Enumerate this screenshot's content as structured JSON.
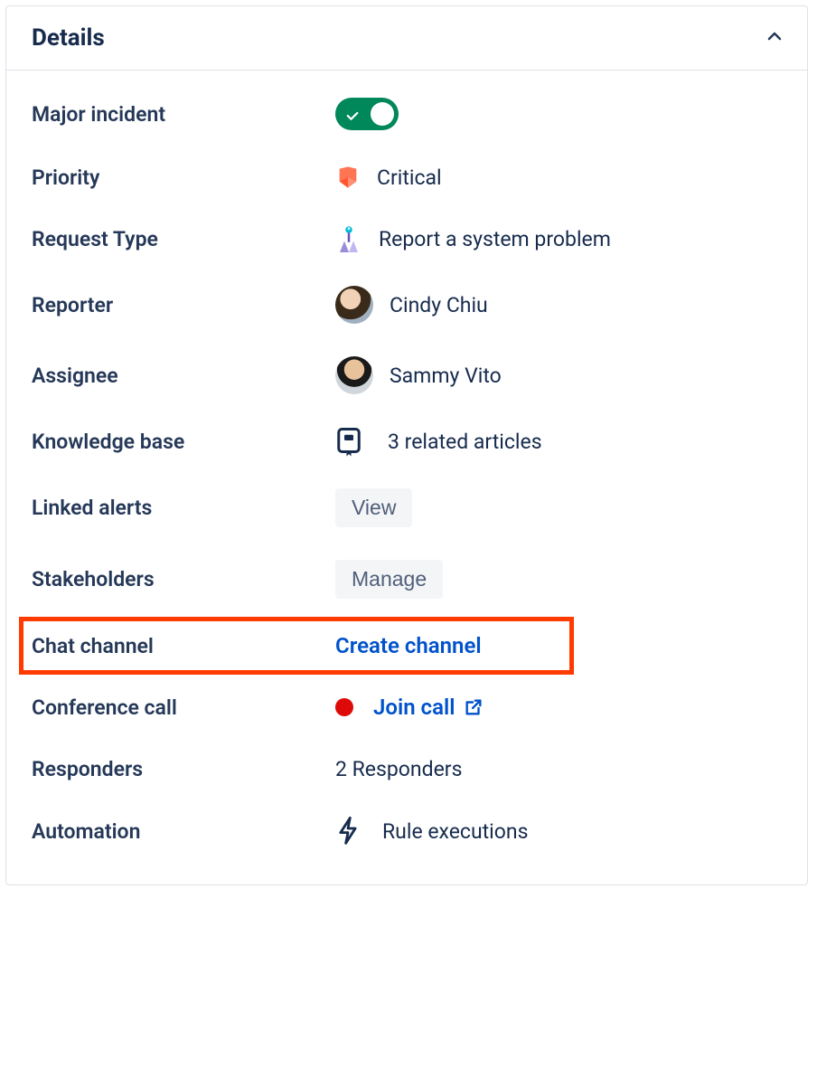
{
  "header": {
    "title": "Details"
  },
  "fields": {
    "major_incident_label": "Major incident",
    "priority_label": "Priority",
    "priority_value": "Critical",
    "request_type_label": "Request Type",
    "request_type_value": "Report a system problem",
    "reporter_label": "Reporter",
    "reporter_value": "Cindy Chiu",
    "assignee_label": "Assignee",
    "assignee_value": "Sammy Vito",
    "kb_label": "Knowledge base",
    "kb_value": "3 related articles",
    "linked_alerts_label": "Linked alerts",
    "linked_alerts_button": "View",
    "stakeholders_label": "Stakeholders",
    "stakeholders_button": "Manage",
    "chat_channel_label": "Chat channel",
    "chat_channel_action": "Create channel",
    "conference_label": "Conference call",
    "conference_action": "Join call",
    "responders_label": "Responders",
    "responders_value": "2 Responders",
    "automation_label": "Automation",
    "automation_value": "Rule executions"
  },
  "major_incident_on": true
}
